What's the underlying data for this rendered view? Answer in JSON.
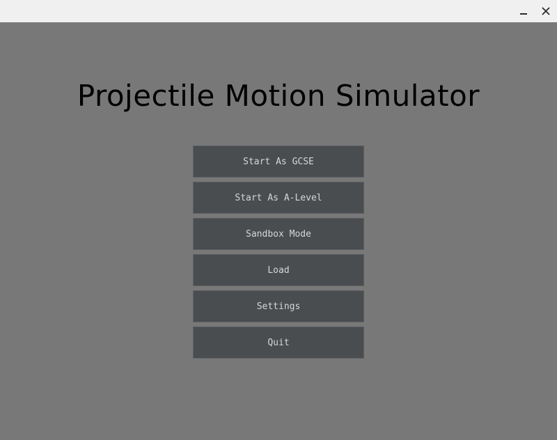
{
  "titlebar": {
    "minimize_icon": "minimize-icon",
    "close_icon": "close-icon"
  },
  "main": {
    "title": "Projectile Motion Simulator",
    "buttons": [
      {
        "label": "Start As GCSE"
      },
      {
        "label": "Start As A-Level"
      },
      {
        "label": "Sandbox Mode"
      },
      {
        "label": "Load"
      },
      {
        "label": "Settings"
      },
      {
        "label": "Quit"
      }
    ]
  },
  "colors": {
    "background": "#787878",
    "titlebar": "#f0f0f0",
    "button": "#4a4d50",
    "button_text": "#d6d6d6"
  }
}
